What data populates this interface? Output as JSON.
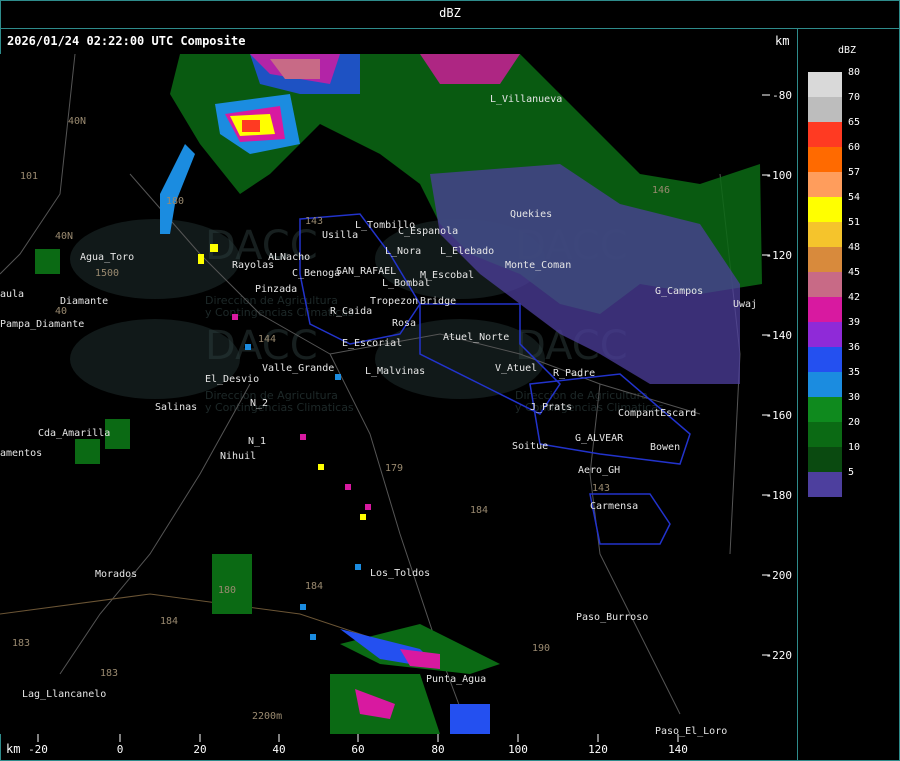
{
  "header": {
    "title": "dBZ"
  },
  "map": {
    "timestamp": "2026/01/24 02:22:00 UTC Composite",
    "km_label_top": "km",
    "km_label_bottom": "km",
    "x_ticks": [
      "-20",
      "0",
      "20",
      "40",
      "60",
      "80",
      "100",
      "120",
      "140"
    ],
    "y_ticks": [
      "-80",
      "-100",
      "-120",
      "-140",
      "-160",
      "-180",
      "-200",
      "-220"
    ],
    "places": [
      "L_Villanueva",
      "L_Tombillo",
      "Usilla",
      "C_Espanola",
      "L_Elebado",
      "Quekies",
      "Agua_Toro",
      "Rayolas",
      "ALNacho",
      "C_Benoga",
      "SAN_RAFAEL",
      "Monte_Coman",
      "L_Nora",
      "M_Escobal",
      "G_Campos",
      "Pampa_Diamante",
      "Diamante",
      "Pinzada",
      "L_Bombal",
      "Tropezon",
      "Bridge",
      "R_Caida",
      "Rosa",
      "Atuel_Norte",
      "E_Escorial",
      "Valle_Grande",
      "L_Malvinas",
      "V_Atuel",
      "R_Padre",
      "El_Desvio",
      "Salinas",
      "N_2",
      "J_Prats",
      "CompantEscard",
      "Cda_Amarilla",
      "G_ALVEAR",
      "Bowen",
      "amentos",
      "N_1",
      "Nihuil",
      "Soitue",
      "Aero_GH",
      "Carmensa",
      "Morados",
      "Los_Toldos",
      "Paso_Burroso",
      "Punta_Agua",
      "Lag_Llancanelo",
      "Paso_El_Loro",
      "aula",
      "Uwaj"
    ],
    "road_numbers": [
      "101",
      "40N",
      "40N",
      "40",
      "143",
      "144",
      "146",
      "180",
      "184",
      "184",
      "190",
      "183",
      "143",
      "179",
      "180",
      "184",
      "183",
      "2200m",
      "1500"
    ],
    "watermark_text": "DACC",
    "watermark_sub_1": "Direccion de Agricultura",
    "watermark_sub_2": "y Contingencias Climaticas"
  },
  "legend": {
    "title": "dBZ",
    "levels": [
      {
        "label": "80",
        "color": "#d9d9d9"
      },
      {
        "label": "70",
        "color": "#bdbdbd"
      },
      {
        "label": "65",
        "color": "#ff3a22"
      },
      {
        "label": "60",
        "color": "#ff6a00"
      },
      {
        "label": "57",
        "color": "#ff9d5c"
      },
      {
        "label": "54",
        "color": "#ffff00"
      },
      {
        "label": "51",
        "color": "#f5c42c"
      },
      {
        "label": "48",
        "color": "#d88a3c"
      },
      {
        "label": "45",
        "color": "#c86a86"
      },
      {
        "label": "42",
        "color": "#d819a0"
      },
      {
        "label": "39",
        "color": "#8f2ad8"
      },
      {
        "label": "36",
        "color": "#2450f0"
      },
      {
        "label": "35",
        "color": "#1b8ce0"
      },
      {
        "label": "30",
        "color": "#0f8a1e"
      },
      {
        "label": "20",
        "color": "#0b6a14"
      },
      {
        "label": "10",
        "color": "#0a4a10"
      },
      {
        "label": "5",
        "color": "#4d3f9e"
      }
    ]
  }
}
